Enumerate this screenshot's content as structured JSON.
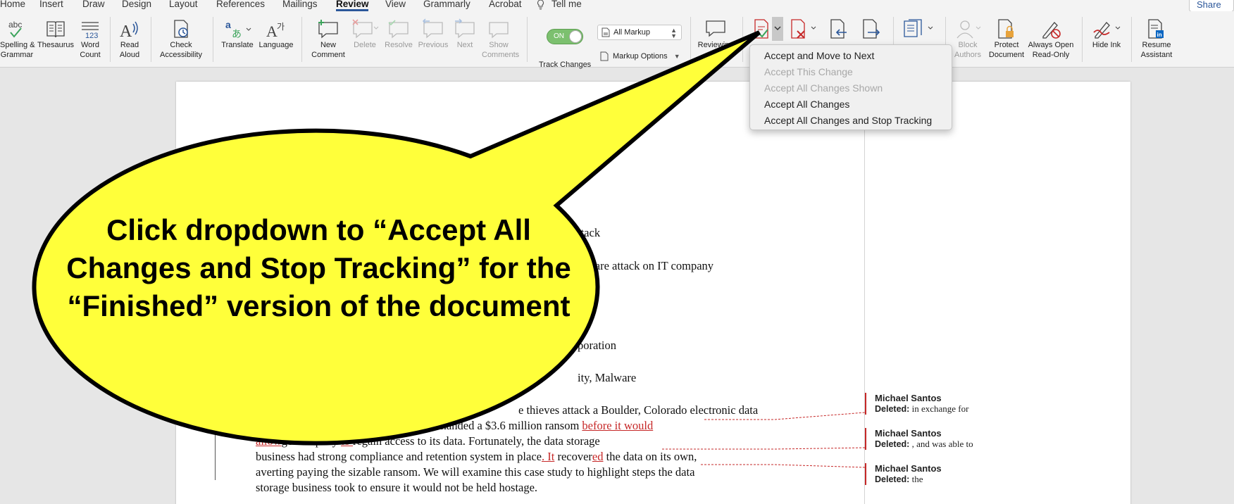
{
  "tabs": [
    "Home",
    "Insert",
    "Draw",
    "Design",
    "Layout",
    "References",
    "Mailings",
    "Review",
    "View",
    "Grammarly",
    "Acrobat"
  ],
  "active_tab": "Review",
  "tell_me": "Tell me",
  "share": "Share",
  "ribbon": {
    "spelling": [
      "Spelling &",
      "Grammar"
    ],
    "thesaurus": "Thesaurus",
    "word_count": [
      "Word",
      "Count"
    ],
    "read_aloud": [
      "Read",
      "Aloud"
    ],
    "check_accessibility": [
      "Check",
      "Accessibility"
    ],
    "translate": "Translate",
    "language": "Language",
    "new_comment": [
      "New",
      "Comment"
    ],
    "delete": "Delete",
    "resolve": "Resolve",
    "previous": "Previous",
    "next": "Next",
    "show_comments": [
      "Show",
      "Comments"
    ],
    "toggle_on": "ON",
    "track_changes": "Track Changes",
    "markup_select": "All Markup",
    "markup_options": "Markup Options",
    "reviewing": "Reviewing",
    "block_authors": [
      "Block",
      "Authors"
    ],
    "protect_document": [
      "Protect",
      "Document"
    ],
    "always_open_read_only": [
      "Always Open",
      "Read-Only"
    ],
    "hide_ink": "Hide Ink",
    "resume_assistant": [
      "Resume",
      "Assistant"
    ]
  },
  "menu": {
    "items": [
      {
        "label": "Accept and Move to Next",
        "enabled": true
      },
      {
        "label": "Accept This Change",
        "enabled": false
      },
      {
        "label": "Accept All Changes Shown",
        "enabled": false
      },
      {
        "label": "Accept All Changes",
        "enabled": true
      },
      {
        "label": "Accept All Changes and Stop Tracking",
        "enabled": true
      }
    ]
  },
  "callout_text": "Click dropdown to “Accept All Changes and Stop Tracking” for the “Finished” version of the document",
  "document": {
    "frag1": "ttack",
    "frag2": "mware attack on IT company",
    "frag3": "poration",
    "frag4": "ity, Malware",
    "p1": "e thieves attack a Boulder, Colorado electronic data",
    "p2a": "criminals demanded a $3.6 million ransom ",
    "p2b": "before it would",
    "p3a": "allow",
    "p3b": "ge company ",
    "p3c": "to ",
    "p3d": "regain access to its data.  Fortunately, the data storage",
    "p4a": "business had strong compliance and retention system in place",
    "p4b": ". It",
    "p4c": " recover",
    "p4d": "ed",
    "p4e": " the data on its own,",
    "p5": "averting paying the sizable ransom.  We will examine this case study to highlight steps the data",
    "p6": "storage business took to ensure it would not be held hostage."
  },
  "comments": [
    {
      "author": "Michael Santos",
      "label": "Deleted:",
      "text": " in exchange for"
    },
    {
      "author": "Michael Santos",
      "label": "Deleted:",
      "text": " , and was able to"
    },
    {
      "author": "Michael Santos",
      "label": "Deleted:",
      "text": " the"
    }
  ]
}
